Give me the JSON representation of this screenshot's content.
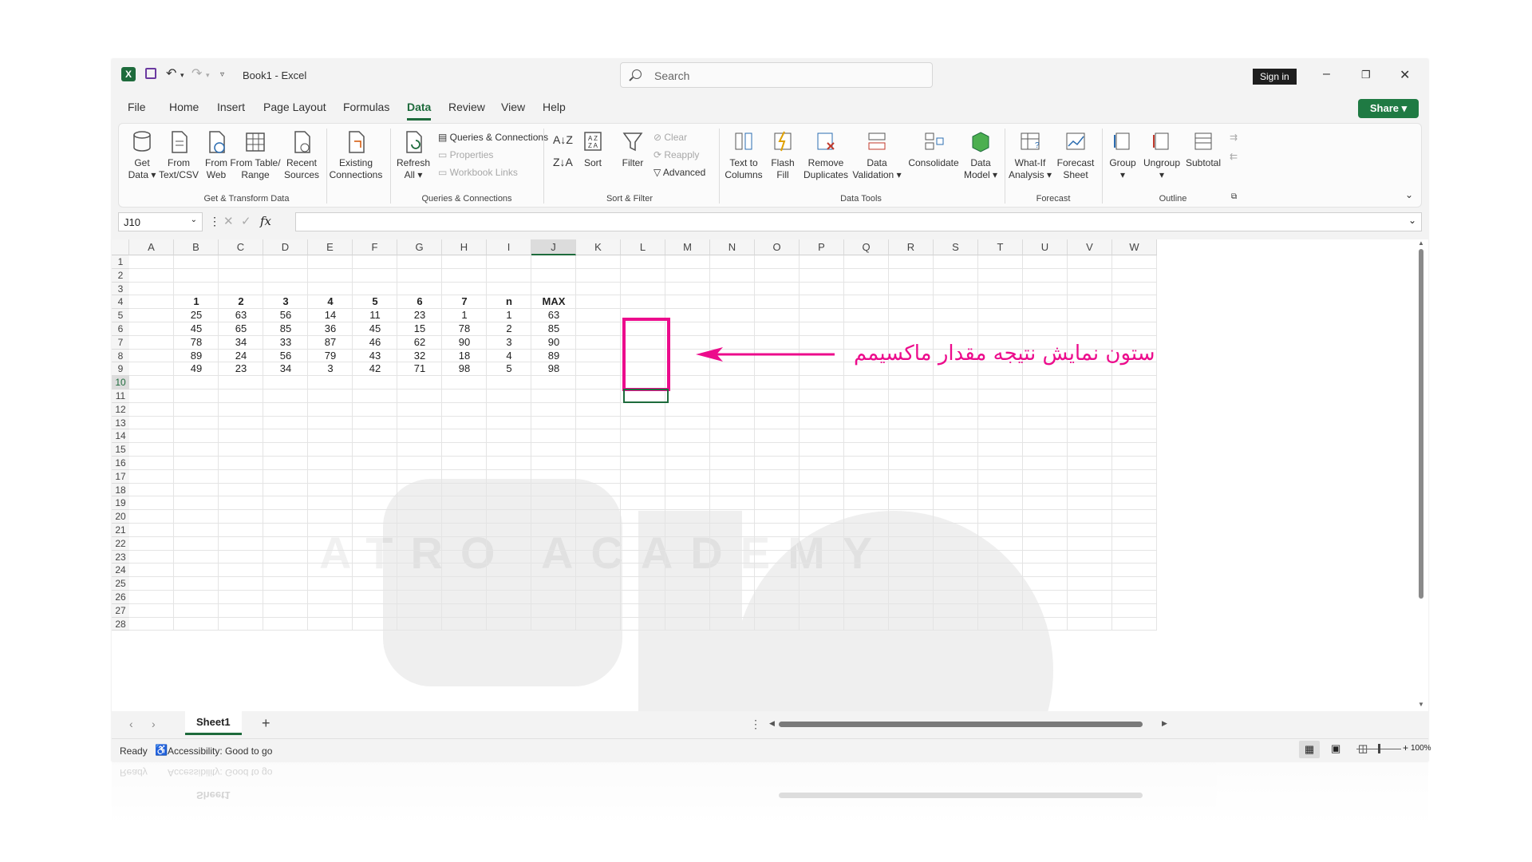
{
  "titlebar": {
    "doc_title": "Book1",
    "sep": "-",
    "app_name": "Excel",
    "search_placeholder": "Search",
    "signin_label": "Sign in"
  },
  "menu": {
    "items": [
      "File",
      "Home",
      "Insert",
      "Page Layout",
      "Formulas",
      "Data",
      "Review",
      "View",
      "Help"
    ],
    "active": "Data",
    "share_label": "Share"
  },
  "ribbon": {
    "get_data": [
      "Get",
      "Data"
    ],
    "from_text": [
      "From",
      "Text/CSV"
    ],
    "from_web": [
      "From",
      "Web"
    ],
    "from_table": [
      "From Table/",
      "Range"
    ],
    "recent_sources": [
      "Recent",
      "Sources"
    ],
    "existing_connections": [
      "Existing",
      "Connections"
    ],
    "refresh_all": [
      "Refresh",
      "All"
    ],
    "queries_connections": "Queries & Connections",
    "properties": "Properties",
    "workbook_links": "Workbook Links",
    "sort_label": "Sort",
    "filter_label": "Filter",
    "clear_label": "Clear",
    "reapply_label": "Reapply",
    "advanced_label": "Advanced",
    "text_to_columns": [
      "Text to",
      "Columns"
    ],
    "flash_fill": [
      "Flash",
      "Fill"
    ],
    "remove_duplicates": [
      "Remove",
      "Duplicates"
    ],
    "data_validation": [
      "Data",
      "Validation"
    ],
    "consolidate": "Consolidate",
    "data_model": [
      "Data",
      "Model"
    ],
    "what_if": [
      "What-If",
      "Analysis"
    ],
    "forecast_sheet": [
      "Forecast",
      "Sheet"
    ],
    "group": "Group",
    "ungroup": "Ungroup",
    "subtotal": "Subtotal",
    "groups": {
      "get_transform": "Get & Transform Data",
      "queries": "Queries & Connections",
      "sort_filter": "Sort & Filter",
      "data_tools": "Data Tools",
      "forecast": "Forecast",
      "outline": "Outline"
    }
  },
  "formula_bar": {
    "name_box": "J10",
    "formula": ""
  },
  "sheet": {
    "columns": [
      "A",
      "B",
      "C",
      "D",
      "E",
      "F",
      "G",
      "H",
      "I",
      "J",
      "K",
      "L",
      "M",
      "N",
      "O",
      "P",
      "Q",
      "R",
      "S",
      "T",
      "U",
      "V",
      "W"
    ],
    "selected_column": "J",
    "selected_row": 10,
    "row_count": 28,
    "header_row": [
      "1",
      "2",
      "3",
      "4",
      "5",
      "6",
      "7",
      "n",
      "MAX"
    ],
    "data_rows": [
      [
        "25",
        "63",
        "56",
        "14",
        "11",
        "23",
        "1",
        "1",
        "63"
      ],
      [
        "45",
        "65",
        "85",
        "36",
        "45",
        "15",
        "78",
        "2",
        "85"
      ],
      [
        "78",
        "34",
        "33",
        "87",
        "46",
        "62",
        "90",
        "3",
        "90"
      ],
      [
        "89",
        "24",
        "56",
        "79",
        "43",
        "32",
        "18",
        "4",
        "89"
      ],
      [
        "49",
        "23",
        "34",
        "3",
        "42",
        "71",
        "98",
        "5",
        "98"
      ]
    ]
  },
  "annotation": {
    "text": "ستون نمایش نتیجه مقدار ماکسیمم",
    "color": "#ec0c8c"
  },
  "watermark_text": "ATRO ACADEMY",
  "tabs": {
    "sheet_name": "Sheet1",
    "add_label": "+"
  },
  "status": {
    "ready": "Ready",
    "accessibility": "Accessibility: Good to go",
    "zoom": "100%"
  },
  "colors": {
    "excel_green": "#1e6b3c",
    "share_green": "#1f7a43",
    "highlight_pink": "#ec0c8c"
  }
}
